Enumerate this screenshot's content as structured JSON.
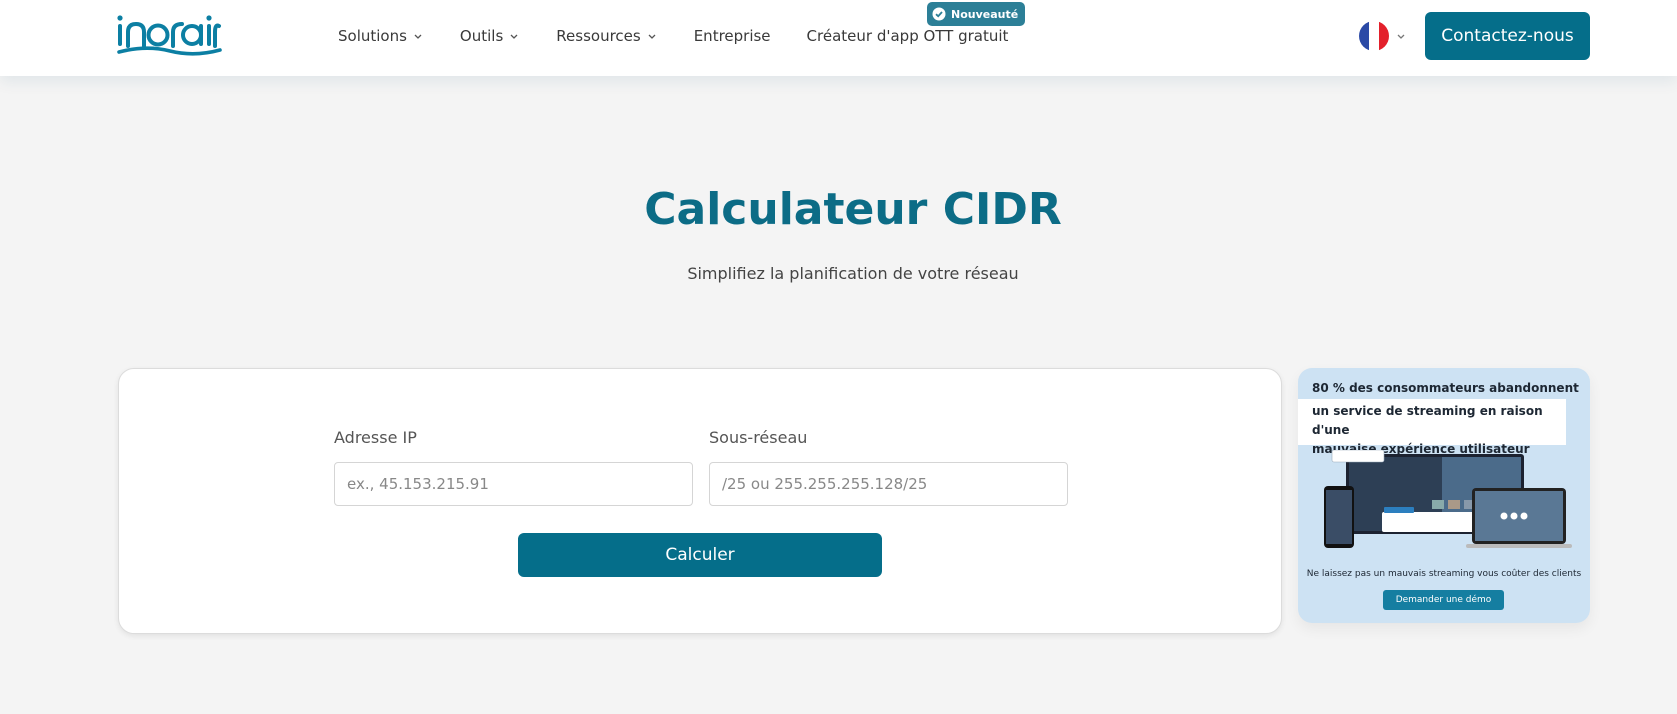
{
  "header": {
    "logo_text": "inorain",
    "nav": [
      {
        "label": "Solutions",
        "has_dropdown": true
      },
      {
        "label": "Outils",
        "has_dropdown": true
      },
      {
        "label": "Ressources",
        "has_dropdown": true
      },
      {
        "label": "Entreprise",
        "has_dropdown": false
      },
      {
        "label": "Créateur d'app OTT gratuit",
        "has_dropdown": false
      }
    ],
    "badge": "Nouveauté",
    "language_flag": "france-flag-icon",
    "contact_label": "Contactez-nous"
  },
  "hero": {
    "title": "Calculateur CIDR",
    "subtitle": "Simplifiez la planification de votre réseau"
  },
  "calculator": {
    "ip_label": "Adresse IP",
    "ip_placeholder": "ex., 45.153.215.91",
    "ip_value": "",
    "subnet_label": "Sous-réseau",
    "subnet_placeholder": "/25 ou 255.255.255.128/25",
    "subnet_value": "",
    "button_label": "Calculer"
  },
  "promo": {
    "line1": "80 % des consommateurs abandonnent",
    "line2": "un service de streaming en raison d'une",
    "line3": "mauvaise expérience utilisateur",
    "caption": "Ne laissez pas un mauvais streaming vous coûter des clients",
    "button_label": "Demander une démo"
  },
  "colors": {
    "brand": "#056e8a",
    "title": "#0c6c86",
    "badge": "#2c7f97",
    "page_bg": "#f4f4f4",
    "promo_bg": "#cde2f3"
  }
}
